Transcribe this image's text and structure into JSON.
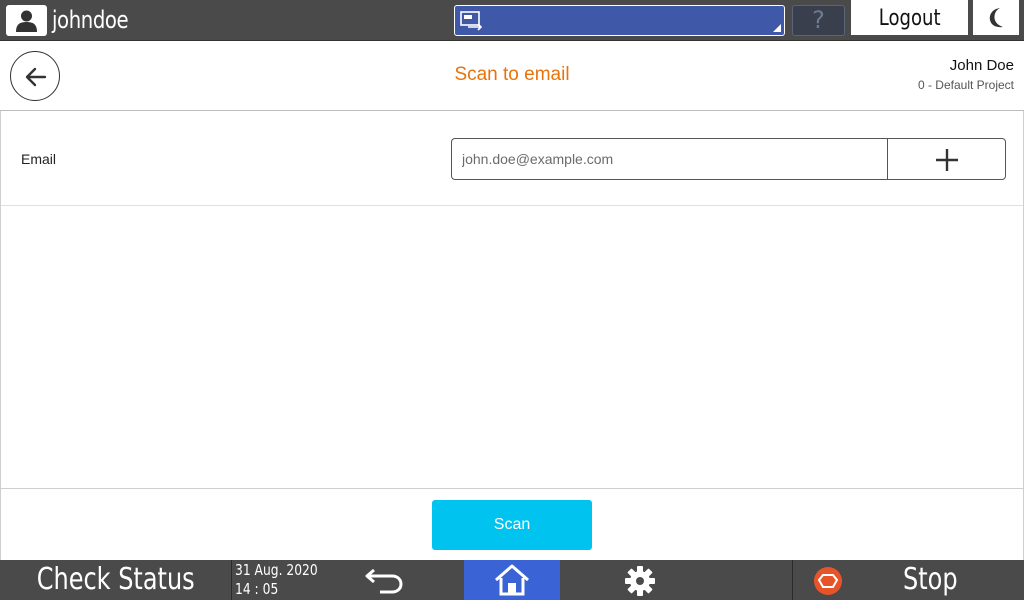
{
  "topbar": {
    "username": "johndoe",
    "help_label": "?",
    "logout_label": "Logout"
  },
  "header": {
    "title": "Scan to email",
    "user_name": "John Doe",
    "project": "0 - Default Project"
  },
  "form": {
    "email_label": "Email",
    "email_placeholder": "john.doe@example.com",
    "email_value": ""
  },
  "actions": {
    "scan_label": "Scan"
  },
  "bottombar": {
    "check_status_label": "Check Status",
    "date": "31 Aug. 2020",
    "time": "14 : 05",
    "stop_label": "Stop"
  },
  "colors": {
    "accent_title": "#e8730a",
    "scan_button": "#00c3f0",
    "home_button": "#3a63d6",
    "top_blue_box": "#3f58a8",
    "stop_icon": "#e8542a"
  }
}
